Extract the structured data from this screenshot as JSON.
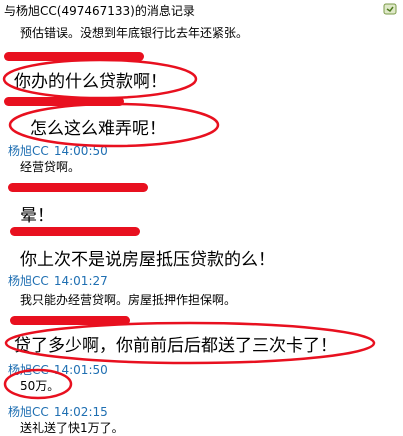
{
  "window": {
    "title": "与杨旭CC(497467133)的消息记录"
  },
  "colors": {
    "sender": "#1f6fb2",
    "annotation_red": "#e8101f"
  },
  "messages": [
    {
      "text": "预估错误。没想到年底银行比去年还紧张。"
    },
    {
      "text": "你办的什么贷款啊！"
    },
    {
      "text": "怎么这么难弄呢！"
    },
    {
      "sender": "杨旭CC",
      "time": "14:00:50",
      "text": "经营贷啊。"
    },
    {
      "text": "晕！"
    },
    {
      "text": "你上次不是说房屋抵压贷款的么！"
    },
    {
      "sender": "杨旭CC",
      "time": "14:01:27",
      "text": "我只能办经营贷啊。房屋抵押作担保啊。"
    },
    {
      "text": "贷了多少啊，你前前后后都送了三次卡了！"
    },
    {
      "sender": "杨旭CC",
      "time": "14:01:50",
      "text": "50万。"
    },
    {
      "sender": "杨旭CC",
      "time": "14:02:15",
      "text": "送礼送了快1万了。"
    }
  ]
}
